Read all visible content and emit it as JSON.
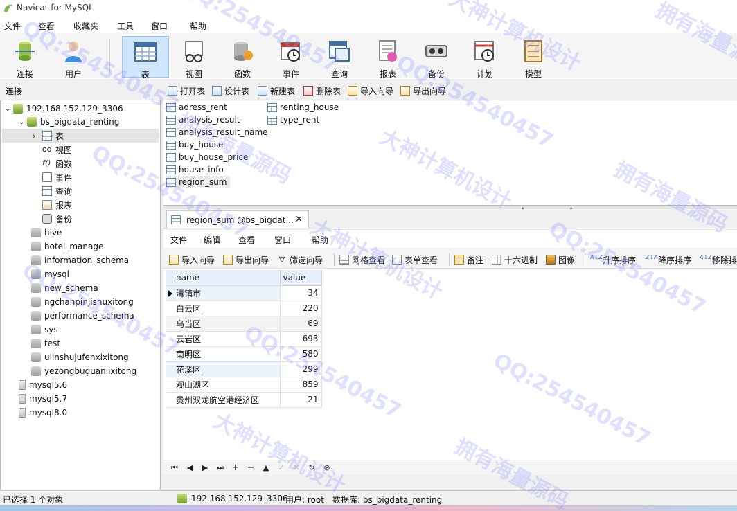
{
  "window": {
    "title": "Navicat for MySQL"
  },
  "menu": [
    "文件",
    "查看",
    "收藏夹",
    "工具",
    "窗口",
    "帮助"
  ],
  "toolbar": [
    {
      "label": "连接",
      "icon": "connect-icon"
    },
    {
      "label": "用户",
      "icon": "user-icon"
    },
    {
      "label": "表",
      "icon": "table-icon",
      "active": true
    },
    {
      "label": "视图",
      "icon": "view-icon"
    },
    {
      "label": "函数",
      "icon": "function-icon"
    },
    {
      "label": "事件",
      "icon": "event-icon"
    },
    {
      "label": "查询",
      "icon": "query-icon"
    },
    {
      "label": "报表",
      "icon": "report-icon"
    },
    {
      "label": "备份",
      "icon": "backup-icon"
    },
    {
      "label": "计划",
      "icon": "schedule-icon"
    },
    {
      "label": "模型",
      "icon": "model-icon"
    }
  ],
  "connection_header": "连接",
  "object_toolbar": [
    "打开表",
    "设计表",
    "新建表",
    "删除表",
    "导入向导",
    "导出向导"
  ],
  "tree": {
    "server": "192.168.152.129_3306",
    "active_db": "bs_bigdata_renting",
    "active_db_children": [
      "表",
      "视图",
      "函数",
      "事件",
      "查询",
      "报表",
      "备份"
    ],
    "databases": [
      "hive",
      "hotel_manage",
      "information_schema",
      "mysql",
      "new_schema",
      "ngchanpinjishuxitong",
      "performance_schema",
      "sys",
      "test",
      "ulinshujufenxixitong",
      "yezongbuguanlixitong"
    ],
    "other_servers": [
      "mysql5.6",
      "mysql5.7",
      "mysql8.0"
    ]
  },
  "objects": {
    "col1": [
      "adress_rent",
      "analysis_result",
      "analysis_result_name",
      "buy_house",
      "buy_house_price",
      "house_info",
      "region_sum"
    ],
    "col2": [
      "renting_house",
      "type_rent"
    ],
    "selected": "region_sum"
  },
  "query_tab": {
    "title": "region_sum @bs_bigdat...",
    "close": "×"
  },
  "inner_menu": [
    "文件",
    "编辑",
    "查看",
    "窗口",
    "帮助"
  ],
  "inner_toolbar": [
    "导入向导",
    "导出向导",
    "筛选向导",
    "网格查看",
    "表单查看",
    "备注",
    "十六进制",
    "图像",
    "升序排序",
    "降序排序",
    "移除排"
  ],
  "grid": {
    "columns": [
      "name",
      "value"
    ],
    "rows": [
      {
        "name": "清镇市",
        "value": "34"
      },
      {
        "name": "白云区",
        "value": "220"
      },
      {
        "name": "乌当区",
        "value": "69"
      },
      {
        "name": "云岩区",
        "value": "693"
      },
      {
        "name": "南明区",
        "value": "580"
      },
      {
        "name": "花溪区",
        "value": "299"
      },
      {
        "name": "观山湖区",
        "value": "859"
      },
      {
        "name": "贵州双龙航空港经济区",
        "value": "21"
      }
    ]
  },
  "status": {
    "selection": "已选择 1 个对象",
    "server": "192.168.152.129_3306",
    "user": "用户: root",
    "database": "数据库: bs_bigdata_renting"
  },
  "watermarks": [
    "QQ:254540457",
    "大神计算机设计",
    "拥有海量源码"
  ]
}
